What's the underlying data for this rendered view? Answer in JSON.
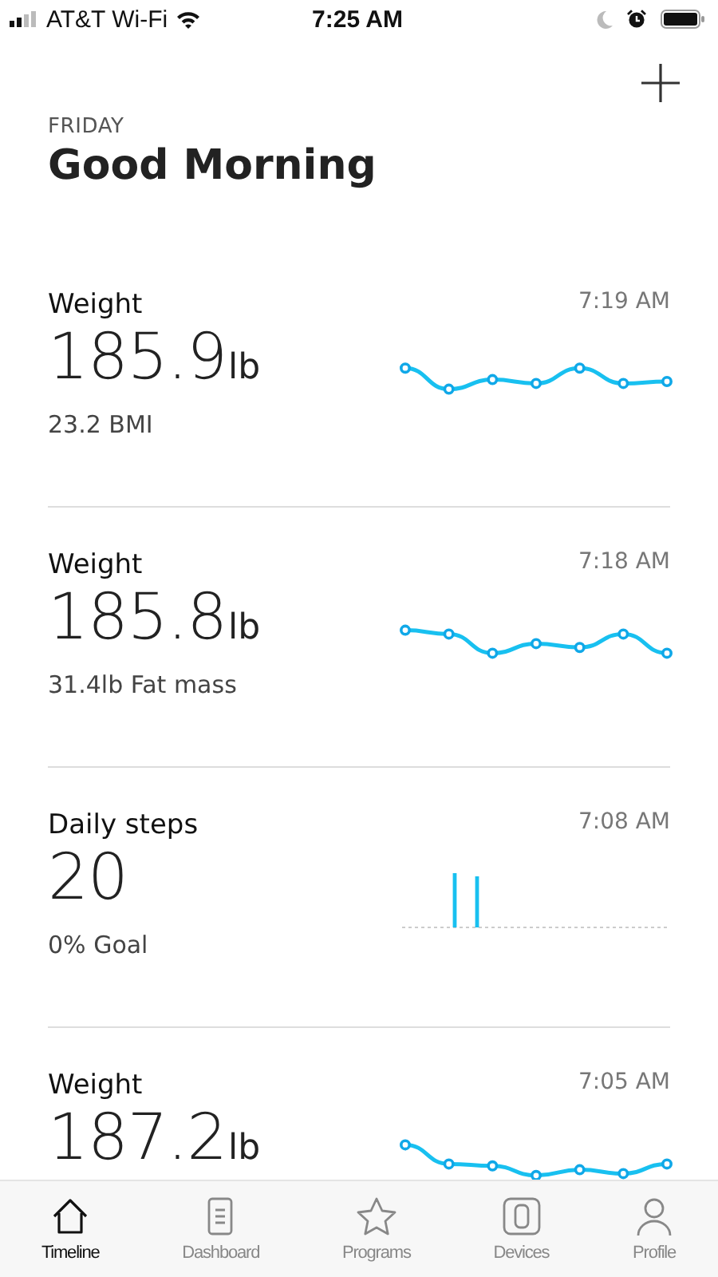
{
  "status_bar": {
    "carrier": "AT&T Wi-Fi",
    "time": "7:25 AM"
  },
  "header": {
    "day": "FRIDAY",
    "greeting": "Good Morning"
  },
  "entries": [
    {
      "title": "Weight",
      "time": "7:19 AM",
      "value": "185.9",
      "unit": "lb",
      "detail": "23.2 BMI",
      "kind": "line"
    },
    {
      "title": "Weight",
      "time": "7:18 AM",
      "value": "185.8",
      "unit": "lb",
      "detail": "31.4lb Fat mass",
      "kind": "line"
    },
    {
      "title": "Daily steps",
      "time": "7:08 AM",
      "value": "20",
      "detail": "0% Goal",
      "kind": "bars"
    },
    {
      "title": "Weight",
      "time": "7:05 AM",
      "value": "187.2",
      "unit": "lb",
      "kind": "line"
    }
  ],
  "tabs": [
    {
      "label": "Timeline",
      "selected": true
    },
    {
      "label": "Dashboard",
      "selected": false
    },
    {
      "label": "Programs",
      "selected": false
    },
    {
      "label": "Devices",
      "selected": false
    },
    {
      "label": "Profile",
      "selected": false
    }
  ]
}
